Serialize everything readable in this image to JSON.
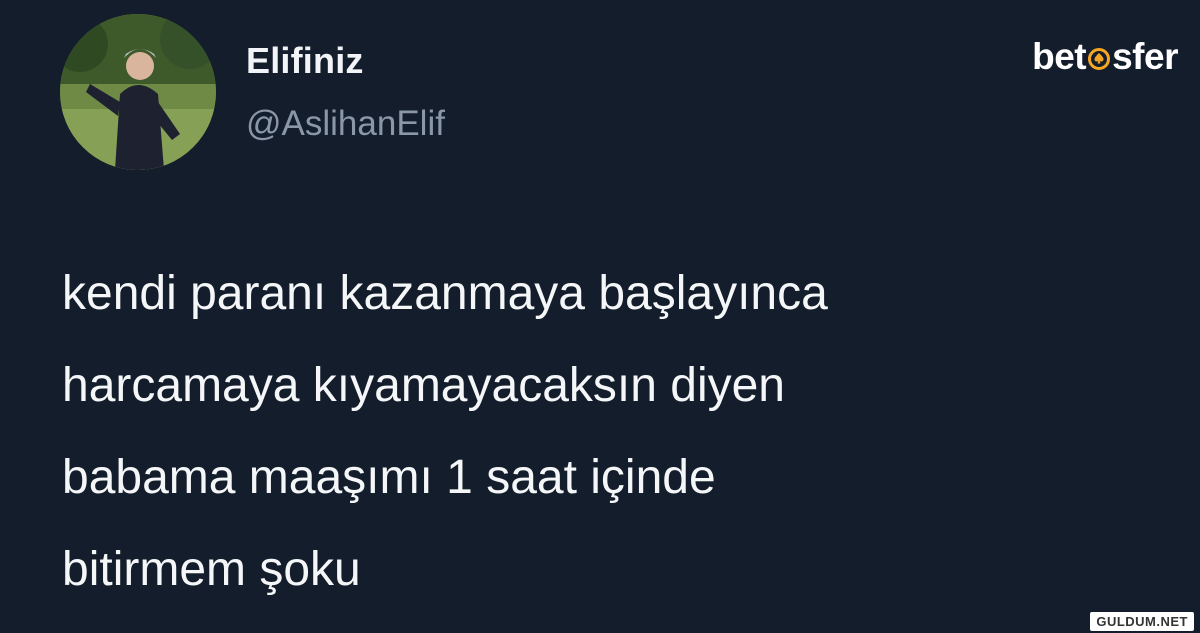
{
  "tweet": {
    "display_name": "Elifiniz",
    "handle": "@AslihanElif",
    "text_lines": [
      "kendi paranı kazanmaya başlayınca",
      "harcamaya kıyamayacaksın diyen",
      "babama maaşımı 1 saat içinde",
      "bitirmem şoku"
    ]
  },
  "watermark": {
    "brand_before": "bet",
    "brand_after": "sfer",
    "accent_color": "#f5a623"
  },
  "footer": {
    "site": "GULDUM.NET"
  },
  "colors": {
    "background": "#141d2b",
    "text": "#f4f6f8",
    "handle": "#8a97a6"
  },
  "icons": {
    "avatar": "profile-photo",
    "watermark_o": "spade-ring-icon"
  }
}
